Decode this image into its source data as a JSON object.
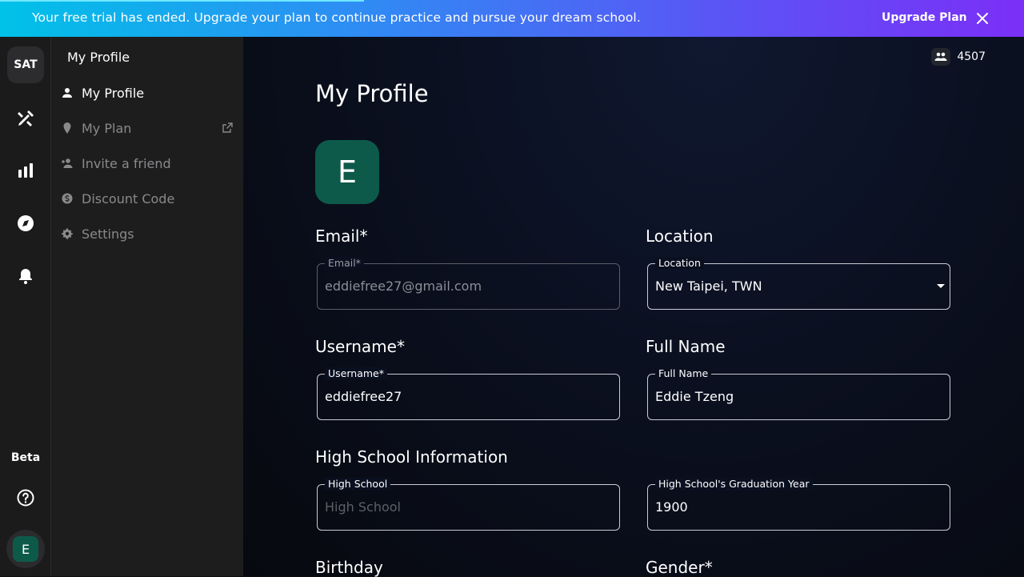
{
  "banner": {
    "message": "Your free trial has ended. Upgrade your plan to continue practice and pursue your dream school.",
    "upgrade_label": "Upgrade Plan"
  },
  "rail": {
    "sat_label": "SAT",
    "beta_label": "Beta",
    "avatar_initial": "E"
  },
  "sidebar": {
    "title": "My Profile",
    "items": [
      {
        "label": "My Profile",
        "icon": "person-icon"
      },
      {
        "label": "My Plan",
        "icon": "pin-icon"
      },
      {
        "label": "Invite a friend",
        "icon": "add-person-icon"
      },
      {
        "label": "Discount Code",
        "icon": "dollar-icon"
      },
      {
        "label": "Settings",
        "icon": "gear-icon"
      }
    ]
  },
  "header": {
    "users_count": "4507"
  },
  "main": {
    "title": "My Profile",
    "avatar_initial": "E",
    "sections": {
      "email": "Email*",
      "location": "Location",
      "username": "Username*",
      "full_name": "Full Name",
      "high_school": "High School Information",
      "birthday": "Birthday",
      "gender": "Gender*"
    },
    "fields": {
      "email": {
        "legend": "Email*",
        "value": "eddiefree27@gmail.com"
      },
      "location": {
        "legend": "Location",
        "value": "New Taipei, TWN"
      },
      "username": {
        "legend": "Username*",
        "value": "eddiefree27"
      },
      "full_name": {
        "legend": "Full Name",
        "value": "Eddie Tzeng"
      },
      "high_school": {
        "legend": "High School",
        "placeholder": "High School"
      },
      "grad_year": {
        "legend": "High School's Graduation Year",
        "value": "1900"
      }
    }
  },
  "colors": {
    "banner_start": "#00c2e8",
    "banner_end": "#7b2ff7",
    "avatar_bg": "#0d5a4a"
  }
}
